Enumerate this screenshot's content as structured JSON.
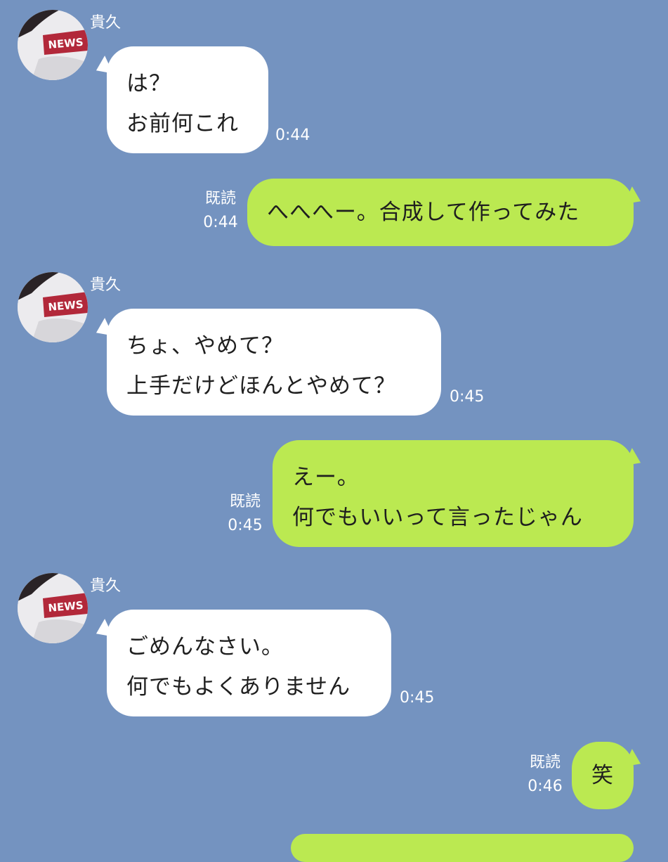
{
  "messages": [
    {
      "sender": "貴久",
      "lines": [
        "は？",
        "お前何これ"
      ],
      "time": "0:44"
    },
    {
      "read": "既読",
      "lines": [
        "へへへー。合成して作ってみた"
      ],
      "time": "0:44"
    },
    {
      "sender": "貴久",
      "lines": [
        "ちょ、やめて？",
        "上手だけどほんとやめて？"
      ],
      "time": "0:45"
    },
    {
      "read": "既読",
      "lines": [
        "えー。",
        "何でもいいって言ったじゃん"
      ],
      "time": "0:45"
    },
    {
      "sender": "貴久",
      "lines": [
        "ごめんなさい。",
        "何でもよくありません"
      ],
      "time": "0:45"
    },
    {
      "read": "既読",
      "lines": [
        "笑"
      ],
      "time": "0:46"
    }
  ],
  "avatar_badge_text": "NEWS",
  "colors": {
    "background": "#7493c0",
    "incoming_bubble": "#ffffff",
    "outgoing_bubble": "#bbe951",
    "meta_text": "#ffffff"
  }
}
